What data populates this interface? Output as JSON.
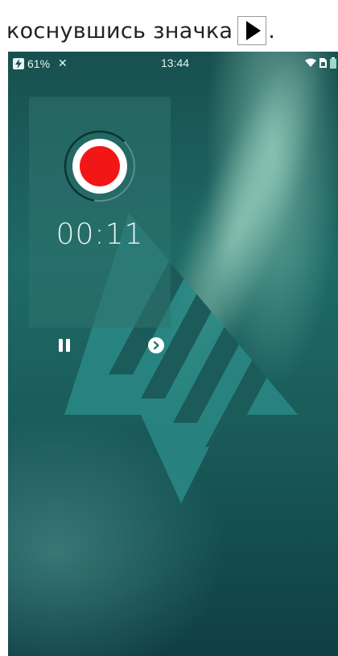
{
  "caption": {
    "text": "коснувшись значка",
    "trailing": ".",
    "icon": "play-icon"
  },
  "status_bar": {
    "battery_percent": "61%",
    "time": "13:44",
    "left_icons": [
      "charging-bolt-icon",
      "tools-icon"
    ],
    "right_icons": [
      "wifi-icon",
      "sim-icon",
      "battery-icon"
    ]
  },
  "recorder": {
    "timer": "00:11",
    "progress": 0.6,
    "colors": {
      "record_dot": "#f21616",
      "ring": "#ffffff",
      "progress_arc": "#0c3431"
    },
    "controls": [
      "pause-icon",
      "next-icon"
    ]
  },
  "wallpaper": {
    "logo": "triangle-stripes-logo",
    "accent": "#1f6a66"
  }
}
